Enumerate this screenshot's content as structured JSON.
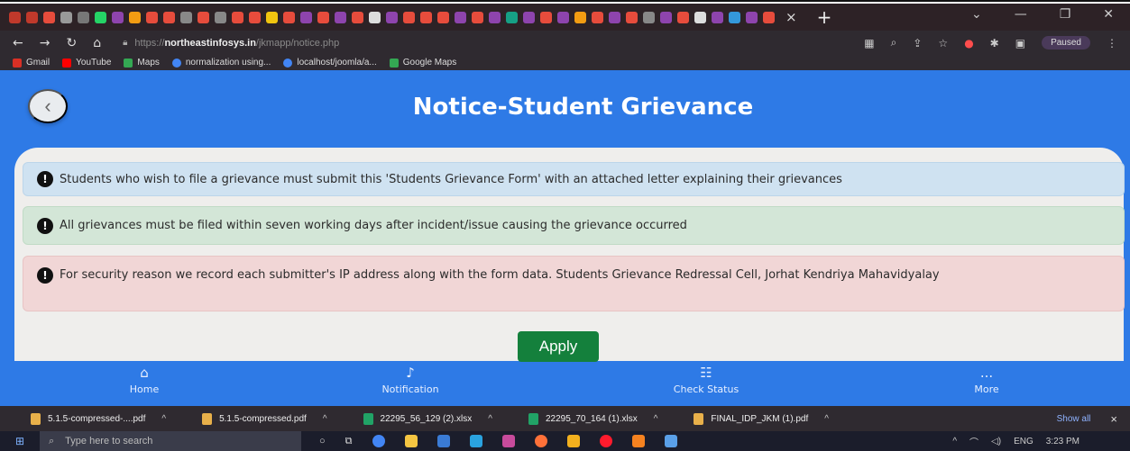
{
  "browser": {
    "tabs_close": "×",
    "new_tab": "+",
    "url_scheme": "https://",
    "url_host": "northeastinfosys.in",
    "url_path": "/jkmapp/notice.php",
    "profile_status": "Paused",
    "bookmarks": [
      {
        "label": "Gmail",
        "color": "#d93025"
      },
      {
        "label": "YouTube",
        "color": "#ff0000"
      },
      {
        "label": "Maps",
        "color": "#34a853"
      },
      {
        "label": "normalization using...",
        "color": "#4285f4"
      },
      {
        "label": "localhost/joomla/a...",
        "color": "#4285f4"
      },
      {
        "label": "Google Maps",
        "color": "#34a853"
      }
    ]
  },
  "app": {
    "back_label": "‹",
    "title": "Notice-Student Grievance",
    "alerts": {
      "info": "Students who wish to file a grievance must submit this 'Students Grievance Form' with an attached letter explaining their grievances",
      "success": "All grievances must be filed within seven working days after incident/issue causing the grievance occurred",
      "danger": "For security reason we record each submitter's IP address along with the form data. Students Grievance Redressal Cell, Jorhat Kendriya Mahavidyalay"
    },
    "alert_icon": "!",
    "apply_label": "Apply",
    "nav": {
      "home": "Home",
      "notification": "Notification",
      "check_status": "Check Status",
      "more": "More",
      "more_icon": "..."
    }
  },
  "downloads": {
    "items": [
      {
        "name": "5.1.5-compressed-....pdf",
        "color": "#e8b04a"
      },
      {
        "name": "5.1.5-compressed.pdf",
        "color": "#e8b04a"
      },
      {
        "name": "22295_56_129 (2).xlsx",
        "color": "#21a366"
      },
      {
        "name": "22295_70_164 (1).xlsx",
        "color": "#21a366"
      },
      {
        "name": "FINAL_IDP_JKM (1).pdf",
        "color": "#e8b04a"
      }
    ],
    "show_all": "Show all",
    "close": "×"
  },
  "taskbar": {
    "search_placeholder": "Type here to search",
    "language": "ENG",
    "time": "3:23 PM"
  },
  "colors": {
    "app_blue": "#2e7ae6",
    "apply_green": "#14803c"
  }
}
